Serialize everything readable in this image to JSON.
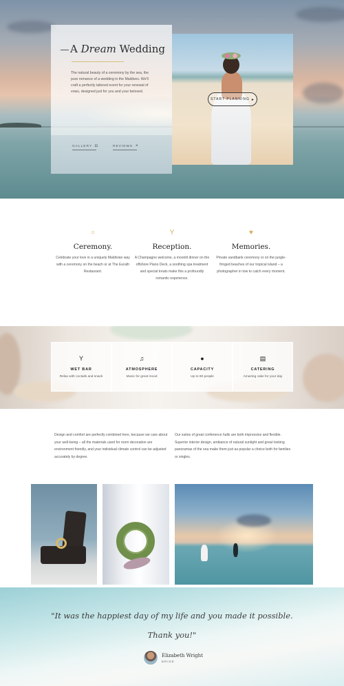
{
  "hero": {
    "title_prefix": "A",
    "title_italic": "Dream",
    "title_suffix": "Wedding",
    "description": "The natural beauty of a ceremony by the sea, the pure romance of a wedding in the Maldives. We'll craft a perfectly tailored event for your renewal of vows, designed just for you and your beloved.",
    "gallery_label": "GALLERY",
    "reviews_label": "REVIEWS",
    "start_button": "START PLANNING",
    "accent_color": "#d3b05f"
  },
  "services": [
    {
      "icon": "ring-icon",
      "glyph": "○",
      "title": "Ceremony.",
      "desc": "Celebrate your love in a uniquely Maldivian way with a ceremony on the beach or at The Eurath Restaurant."
    },
    {
      "icon": "cocktail-icon",
      "glyph": "Y",
      "title": "Reception.",
      "desc": "A Champagne welcome, a moonlit dinner on the offshore Piano Deck, a soothing spa treatment and special treats make this a profoundly romantic experience."
    },
    {
      "icon": "heart-icon",
      "glyph": "♥",
      "title": "Memories.",
      "desc": "Private sandbank ceremony or on the jungle-fringed beaches of our tropical island – a photographer in tow to catch every moment."
    }
  ],
  "amenities": [
    {
      "icon": "cocktail-icon",
      "glyph": "Y",
      "title": "WET BAR",
      "sub": "Relax with coctails and snack"
    },
    {
      "icon": "music-icon",
      "glyph": "♫",
      "title": "ATMOSPHERE",
      "sub": "Music for great mood"
    },
    {
      "icon": "person-icon",
      "glyph": "●",
      "title": "CAPACITY",
      "sub": "Up to 60 people"
    },
    {
      "icon": "cake-icon",
      "glyph": "▤",
      "title": "CATERING",
      "sub": "Amazing cake for your day"
    }
  ],
  "columns": {
    "left": "Design and comfort are perfectly combined here, because we care about your well-being – all the materials used for room decoration are environment friendly, and your individual climate control can be adjusted accurately by degree.",
    "right": "Our suites of great conference halls are both impressive and flexible. Superior interior design, ambiance of natural sunlight and great looking panoramas of the sea make them just as popular a choice both for families or singles."
  },
  "testimonial": {
    "line1": "\"It was the happiest day of my life and you made it possible.",
    "line2": "Thank you!\"",
    "author": "Elizabeth Wright",
    "role": "BRIDE"
  }
}
